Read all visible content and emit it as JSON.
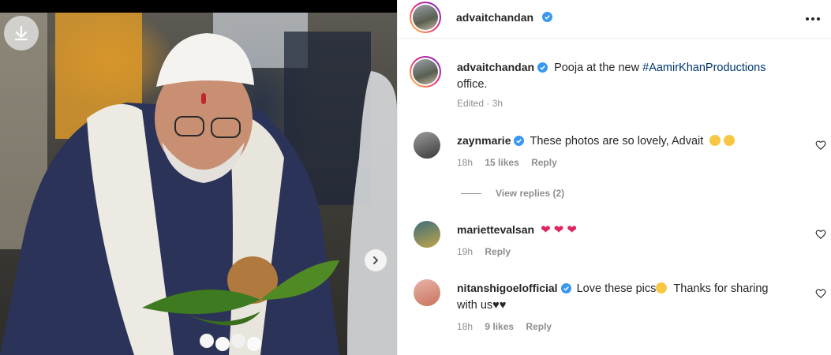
{
  "header": {
    "username": "advaitchandan",
    "more_icon": "more-horizontal-icon"
  },
  "caption": {
    "username": "advaitchandan",
    "text_before": "Pooja at the new ",
    "hashtag": "#AamirKhanProductions",
    "text_after": "office.",
    "time": "Edited · 3h"
  },
  "comments": [
    {
      "username": "zaynmarie",
      "verified": true,
      "text": "These photos are so lovely, Advait",
      "emoji": "crying-face ×2",
      "time": "18h",
      "likes": "15 likes",
      "reply": "Reply"
    },
    {
      "username": "mariettevalsan",
      "verified": false,
      "text": "",
      "emoji": "red-heart ×3",
      "time": "19h",
      "likes": "",
      "reply": "Reply"
    },
    {
      "username": "nitanshigoelofficial",
      "verified": true,
      "text": "Love these pics",
      "text2": "Thanks for sharing",
      "text3": "with us♥♥",
      "time": "18h",
      "likes": "9 likes",
      "reply": "Reply"
    }
  ],
  "view_replies": "View replies (2)",
  "photo": {
    "download_icon": "download-icon",
    "next_icon": "chevron-right-icon"
  },
  "colors": {
    "accent_link": "#00376b",
    "verified": "#3897f0",
    "muted": "#8e8e8e",
    "heart_red": "#e0245e"
  }
}
